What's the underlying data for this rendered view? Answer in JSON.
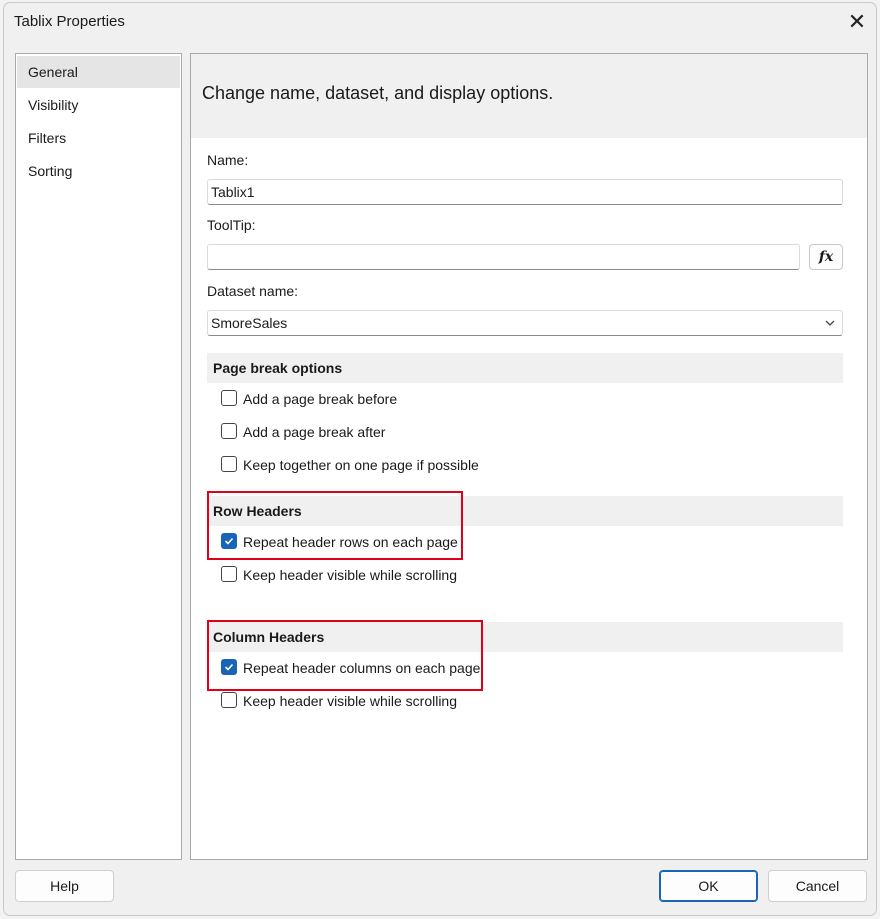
{
  "window": {
    "title": "Tablix Properties",
    "close_glyph": "✕"
  },
  "nav": {
    "items": [
      {
        "label": "General",
        "selected": true
      },
      {
        "label": "Visibility",
        "selected": false
      },
      {
        "label": "Filters",
        "selected": false
      },
      {
        "label": "Sorting",
        "selected": false
      }
    ]
  },
  "content": {
    "heading": "Change name, dataset, and display options.",
    "name": {
      "label": "Name:",
      "value": "Tablix1"
    },
    "tooltip": {
      "label": "ToolTip:",
      "value": "",
      "expression_button": "fx"
    },
    "dataset": {
      "label": "Dataset name:",
      "value": "SmoreSales"
    },
    "page_break": {
      "title": "Page break options",
      "options": [
        {
          "label": "Add a page break before",
          "checked": false
        },
        {
          "label": "Add a page break after",
          "checked": false
        },
        {
          "label": "Keep together on one page if possible",
          "checked": false
        }
      ]
    },
    "row_headers": {
      "title": "Row Headers",
      "options": [
        {
          "label": "Repeat header rows on each page",
          "checked": true
        },
        {
          "label": "Keep header visible while scrolling",
          "checked": false
        }
      ]
    },
    "column_headers": {
      "title": "Column Headers",
      "options": [
        {
          "label": "Repeat header columns on each page",
          "checked": true
        },
        {
          "label": "Keep header visible while scrolling",
          "checked": false
        }
      ]
    }
  },
  "buttons": {
    "help": "Help",
    "ok": "OK",
    "cancel": "Cancel"
  },
  "colors": {
    "accent": "#1a64b8",
    "highlight": "#e0001a"
  }
}
